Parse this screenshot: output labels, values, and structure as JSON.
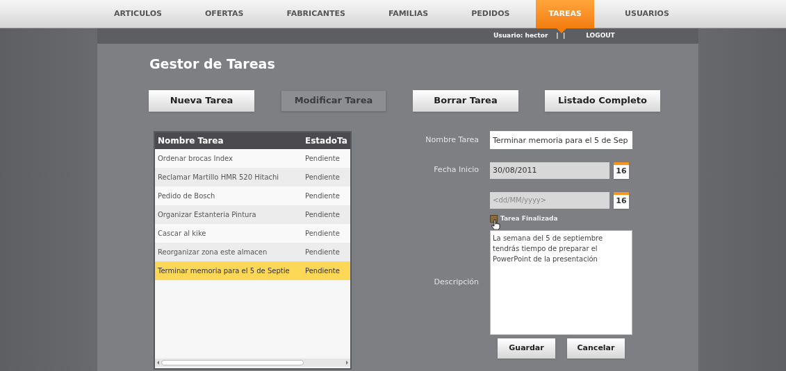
{
  "nav": {
    "tabs": [
      {
        "label": "ARTICULOS",
        "selected": false
      },
      {
        "label": "OFERTAS",
        "selected": false
      },
      {
        "label": "FABRICANTES",
        "selected": false
      },
      {
        "label": "FAMILIAS",
        "selected": false
      },
      {
        "label": "PEDIDOS",
        "selected": false
      },
      {
        "label": "TAREAS",
        "selected": true
      },
      {
        "label": "USUARIOS",
        "selected": false
      }
    ],
    "user": "Usuario: hector",
    "separator": "|  |",
    "logout": "LOGOUT"
  },
  "title": "Gestor de Tareas",
  "actions": [
    {
      "label": "Nueva Tarea",
      "disabled": false
    },
    {
      "label": "Modificar Tarea",
      "disabled": true
    },
    {
      "label": "Borrar Tarea",
      "disabled": false
    },
    {
      "label": "Listado Completo",
      "disabled": false
    }
  ],
  "table": {
    "columns": [
      "Nombre Tarea",
      "EstadoTa"
    ],
    "rows": [
      {
        "cells": [
          "Ordenar brocas Index",
          "Pendiente"
        ],
        "selected": false
      },
      {
        "cells": [
          "Reclamar Martillo HMR 520 Hitachi",
          "Pendiente"
        ],
        "selected": false
      },
      {
        "cells": [
          "Pedido de Bosch",
          "Pendiente"
        ],
        "selected": false
      },
      {
        "cells": [
          "Organizar Estanteria Pintura",
          "Pendiente"
        ],
        "selected": false
      },
      {
        "cells": [
          "Cascar al kike",
          "Pendiente"
        ],
        "selected": false
      },
      {
        "cells": [
          "Reorganizar zona este almacen",
          "Pendiente"
        ],
        "selected": false
      },
      {
        "cells": [
          "Terminar memoria para el 5 de Septie",
          "Pendiente"
        ],
        "selected": true
      }
    ]
  },
  "form": {
    "name": {
      "label": "Nombre Tarea",
      "value": "Terminar memoria para el 5 de Sep"
    },
    "start": {
      "label": "Fecha Inicio",
      "value": "30/08/2011",
      "calendar": "16"
    },
    "end": {
      "placeholder": "<dd/MM/yyyy>",
      "calendar": "16"
    },
    "finished": {
      "label": "Tarea Finalizada",
      "checked": false
    },
    "description": {
      "label": "Descripción",
      "value": "La semana del 5 de septiembre tendrás tiempo de preparar el PowerPoint de la presentación"
    },
    "buttons": [
      "Guardar",
      "Cancelar"
    ]
  }
}
